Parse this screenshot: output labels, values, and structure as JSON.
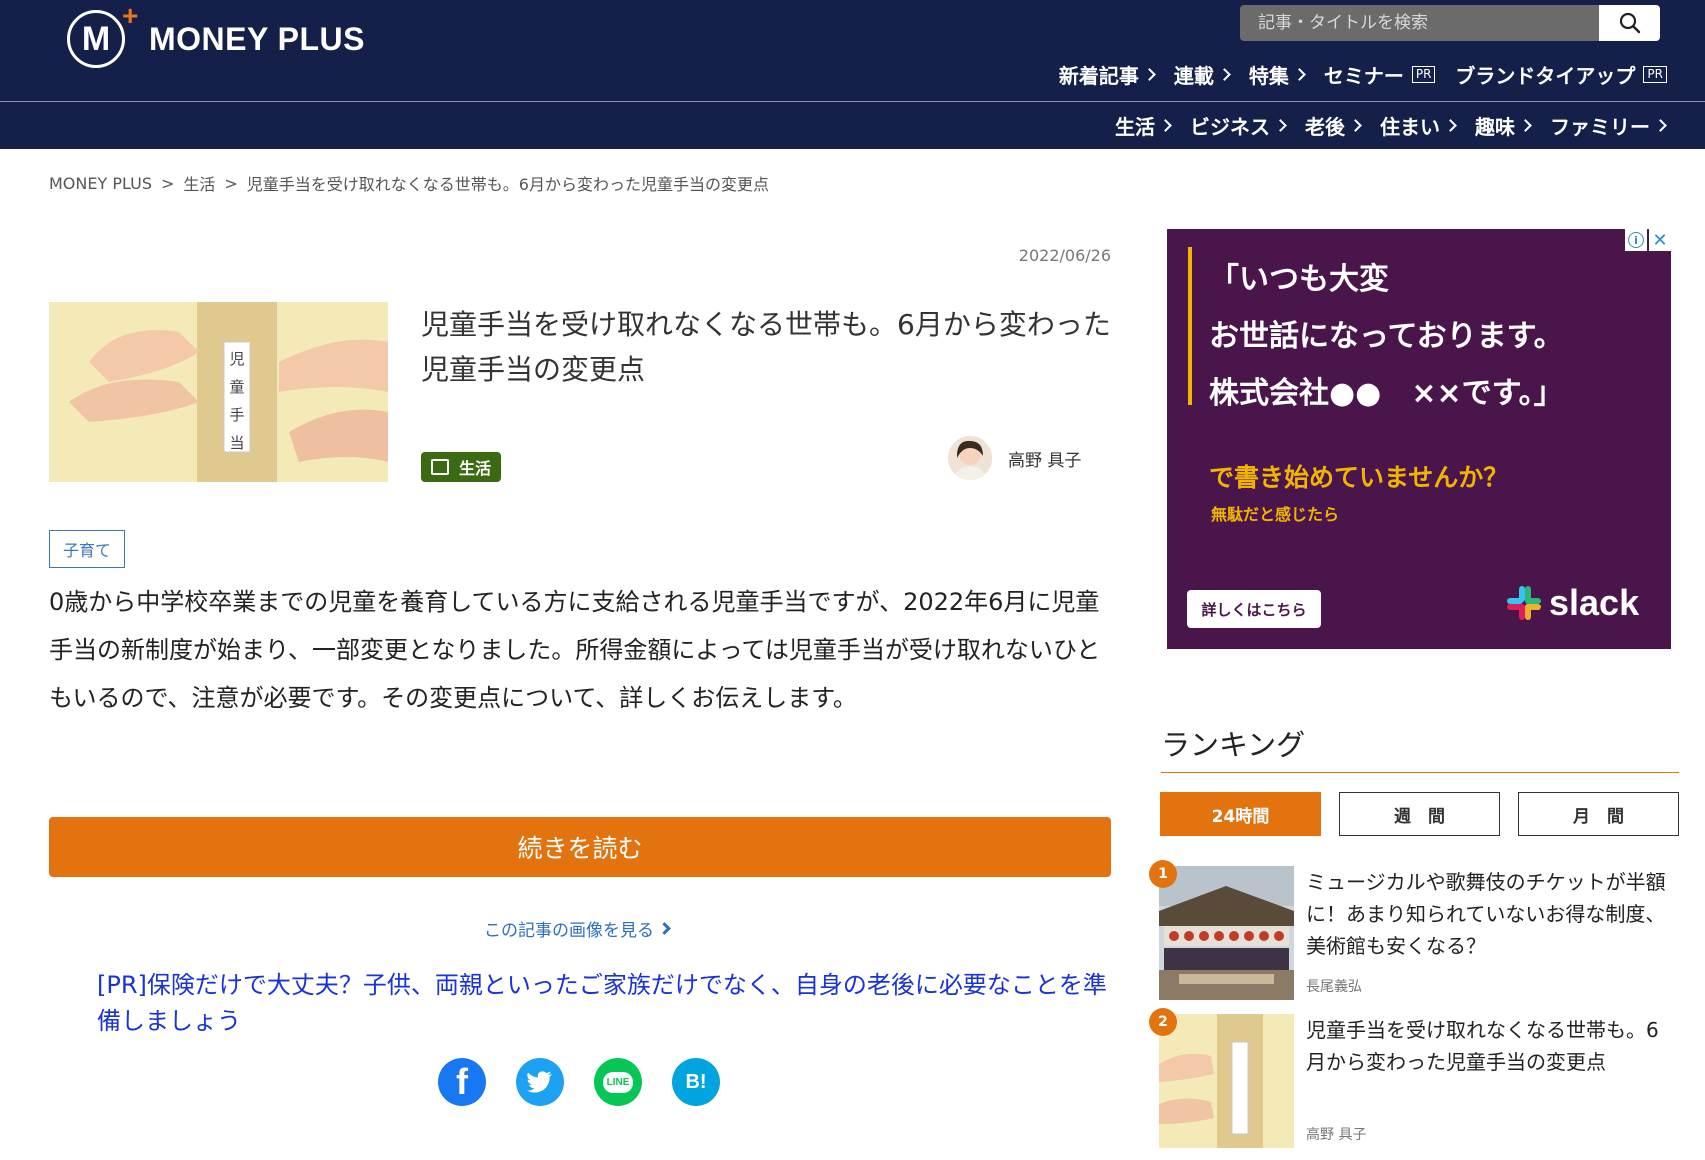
{
  "header": {
    "logo_text": "MONEY PLUS",
    "logo_mark": "M",
    "search_placeholder": "記事・タイトルを検索",
    "nav_primary": [
      {
        "label": "新着記事",
        "pr": ""
      },
      {
        "label": "連載",
        "pr": ""
      },
      {
        "label": "特集",
        "pr": ""
      },
      {
        "label": "セミナー",
        "pr": "PR"
      },
      {
        "label": "ブランドタイアップ",
        "pr": "PR"
      }
    ],
    "nav_categories": [
      "生活",
      "ビジネス",
      "老後",
      "住まい",
      "趣味",
      "ファミリー"
    ]
  },
  "breadcrumb": [
    "MONEY PLUS",
    "生活",
    "児童手当を受け取れなくなる世帯も。6月から変わった児童手当の変更点"
  ],
  "article": {
    "date": "2022/06/26",
    "title": "児童手当を受け取れなくなる世帯も。6月から変わった児童手当の変更点",
    "thumb_label": [
      "児",
      "童",
      "手",
      "当"
    ],
    "category": "生活",
    "author": "高野 具子",
    "tag": "子育て",
    "lead": "0歳から中学校卒業までの児童を養育している方に支給される児童手当ですが、2022年6月に児童手当の新制度が始まり、一部変更となりました。所得金額によっては児童手当が受け取れないひともいるので、注意が必要です。その変更点について、詳しくお伝えします。",
    "read_more": "続きを読む",
    "image_link": "この記事の画像を見る",
    "pr_link": "[PR]保険だけで大丈夫？子供、両親といったご家族だけでなく、自身の老後に必要なことを準備しましょう",
    "social": [
      {
        "name": "facebook",
        "glyph": "f",
        "color": "#1877f2"
      },
      {
        "name": "twitter",
        "glyph": "",
        "color": "#1da1f2"
      },
      {
        "name": "line",
        "glyph": "LINE",
        "color": "#06c755"
      },
      {
        "name": "hatena",
        "glyph": "B!",
        "color": "#00a4de"
      }
    ]
  },
  "ad": {
    "line1": "「いつも大変",
    "line2": "お世話になっております。",
    "line3": "株式会社●●　××です。」",
    "sub": "で書き始めていませんか？",
    "sub_small": "無駄だと感じたら",
    "cta": "詳しくはこちら",
    "brand": "slack",
    "info": "i",
    "close": "✕"
  },
  "ranking": {
    "title": "ランキング",
    "tabs": [
      "24時間",
      "週　間",
      "月　間"
    ],
    "active_tab": 0,
    "items": [
      {
        "rank": "1",
        "title": "ミュージカルや歌舞伎のチケットが半額に！あまり知られていないお得な制度、美術館も安くなる？",
        "author": "長尾義弘"
      },
      {
        "rank": "2",
        "title": "児童手当を受け取れなくなる世帯も。6月から変わった児童手当の変更点",
        "author": "高野 具子"
      }
    ]
  },
  "colors": {
    "header_bg": "#14204a",
    "accent": "#e2730f",
    "category_green": "#3a6b12",
    "link_blue": "#2e6ec2",
    "ad_bg": "#4a154b"
  }
}
